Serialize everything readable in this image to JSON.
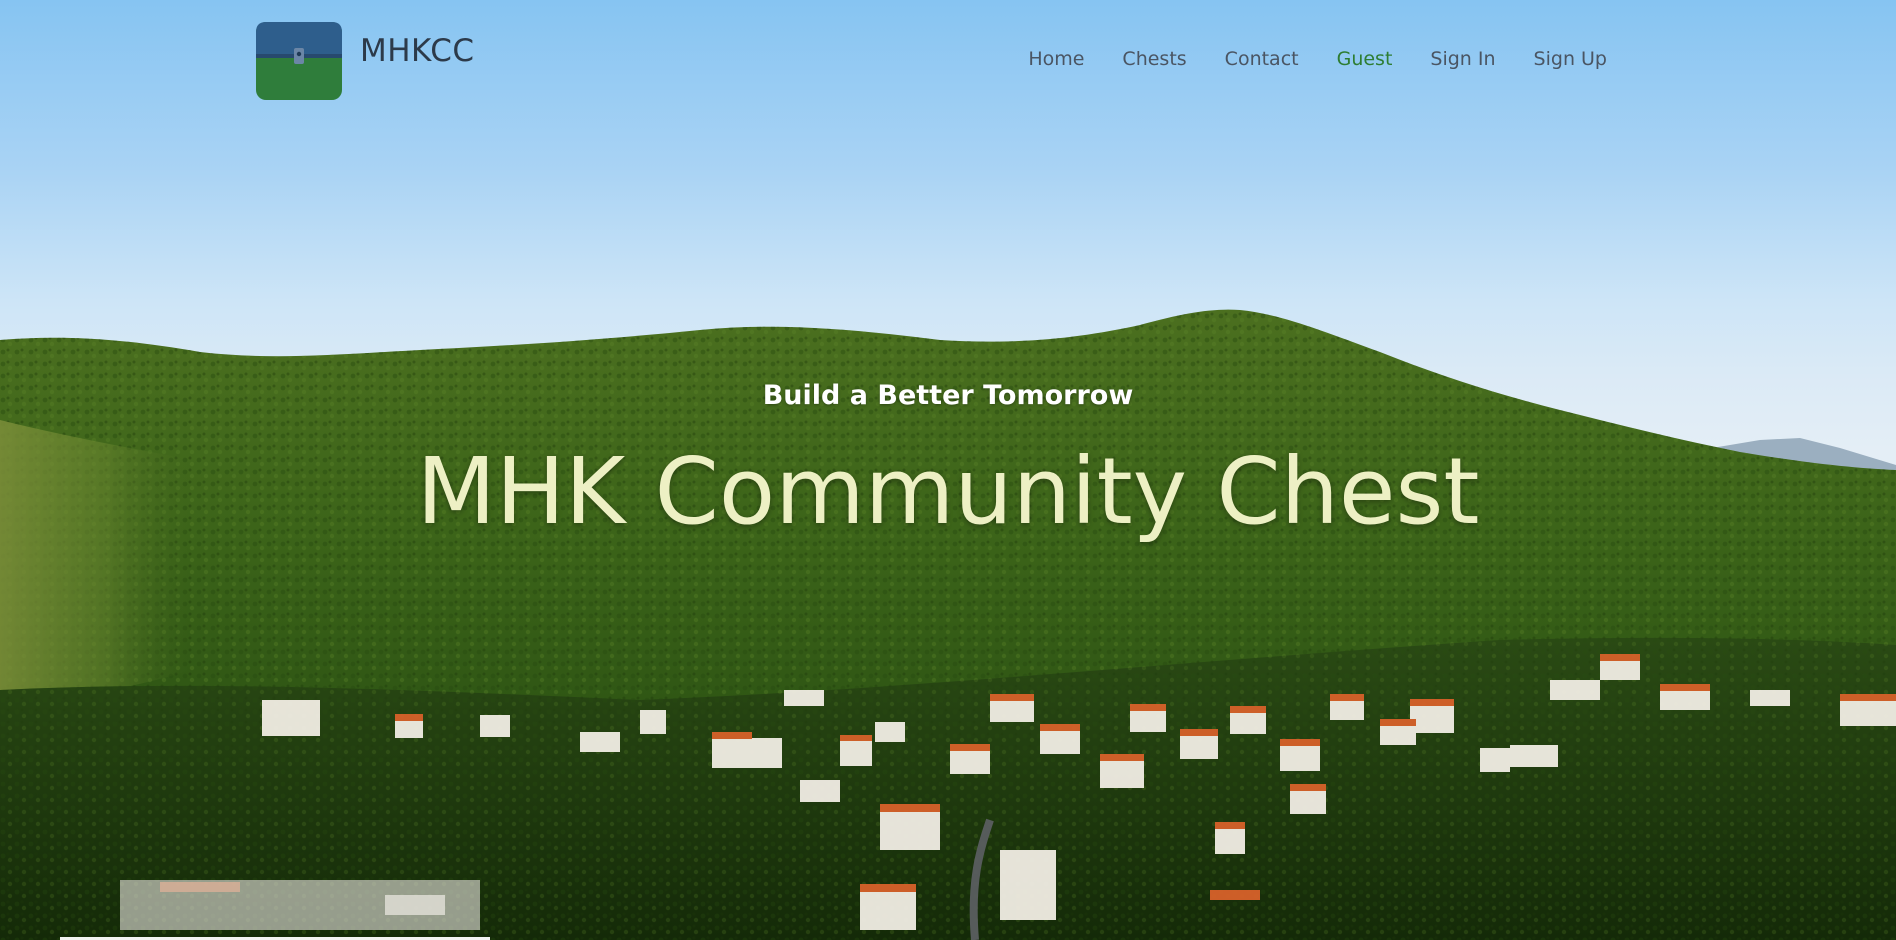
{
  "brand": {
    "name": "MHKCC",
    "logo_icon": "treasure-chest-icon",
    "logo_top_color": "#2e5e8c",
    "logo_bottom_color": "#2f7d3b"
  },
  "nav": {
    "items": [
      {
        "label": "Home",
        "active": false
      },
      {
        "label": "Chests",
        "active": false
      },
      {
        "label": "Contact",
        "active": false
      },
      {
        "label": "Guest",
        "active": true
      },
      {
        "label": "Sign In",
        "active": false
      },
      {
        "label": "Sign Up",
        "active": false
      }
    ],
    "active_color": "#2e7d32"
  },
  "hero": {
    "tagline": "Build a Better Tomorrow",
    "headline": "MHK Community Chest",
    "headline_color": "#edf0c4",
    "background": "hillside-village-photo"
  }
}
